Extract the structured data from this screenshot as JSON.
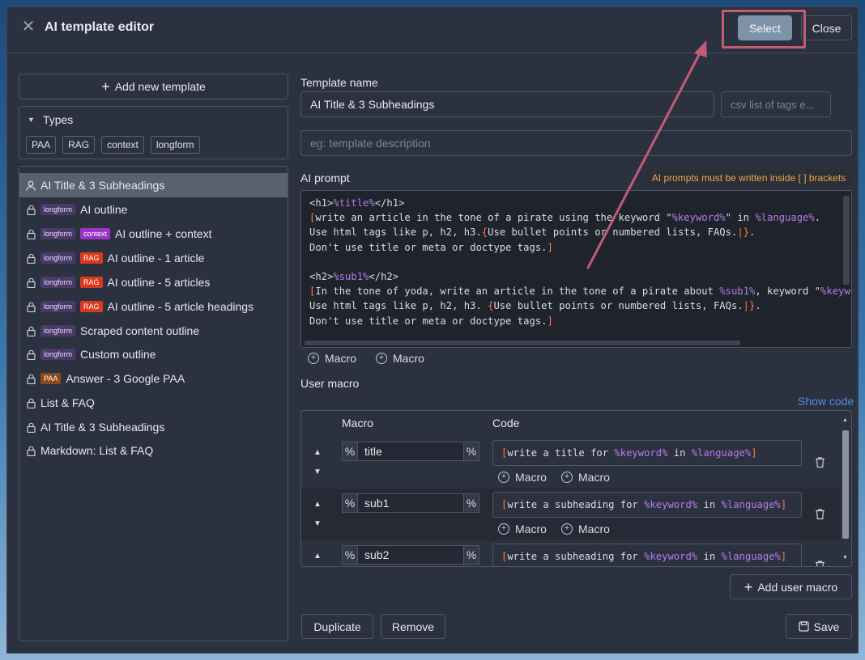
{
  "dialog": {
    "title": "AI template editor",
    "select_label": "Select",
    "close_label": "Close"
  },
  "left": {
    "add_template_label": "Add new template",
    "types_label": "Types",
    "types": [
      "PAA",
      "RAG",
      "context",
      "longform"
    ],
    "templates": [
      {
        "name": "AI Title & 3 Subheadings",
        "tags": [],
        "active": true,
        "icon": "user-icon"
      },
      {
        "name": "AI outline",
        "tags": [
          "longform"
        ]
      },
      {
        "name": "AI outline + context",
        "tags": [
          "longform",
          "context"
        ]
      },
      {
        "name": "AI outline - 1 article",
        "tags": [
          "longform",
          "RAG"
        ]
      },
      {
        "name": "AI outline - 5 articles",
        "tags": [
          "longform",
          "RAG"
        ]
      },
      {
        "name": "AI outline - 5 article headings",
        "tags": [
          "longform",
          "RAG"
        ]
      },
      {
        "name": "Scraped content outline",
        "tags": [
          "longform"
        ]
      },
      {
        "name": "Custom outline",
        "tags": [
          "longform"
        ]
      },
      {
        "name": "Answer - 3 Google PAA",
        "tags": [
          "PAA"
        ]
      },
      {
        "name": "List & FAQ",
        "tags": []
      },
      {
        "name": "AI Title & 3 Subheadings",
        "tags": []
      },
      {
        "name": "Markdown: List & FAQ",
        "tags": []
      }
    ]
  },
  "form": {
    "template_name_label": "Template name",
    "template_name_value": "AI Title & 3 Subheadings",
    "tags_placeholder": "csv list of tags e...",
    "description_placeholder": "eg: template description",
    "ai_prompt_label": "AI prompt",
    "warning": "AI prompts must be written inside [ ] brackets",
    "macro_link_label": "Macro",
    "user_macro_label": "User macro",
    "show_code_label": "Show code"
  },
  "prompt_lines": [
    [
      [
        "t",
        "<h1>"
      ],
      [
        "v",
        "%title%"
      ],
      [
        "t",
        "</h1>"
      ]
    ],
    [
      [
        "b",
        "["
      ],
      [
        "t",
        "write an article in the tone of a pirate using the keyword \""
      ],
      [
        "v",
        "%keyword%"
      ],
      [
        "t",
        "\" in "
      ],
      [
        "v",
        "%language%"
      ],
      [
        "t",
        "."
      ]
    ],
    [
      [
        "t",
        "Use html tags like p, h2, h3."
      ],
      [
        "b",
        "{"
      ],
      [
        "t",
        "Use bullet points or numbered lists, FAQs."
      ],
      [
        "b",
        "|"
      ],
      [
        "b",
        "}"
      ],
      [
        "t",
        "."
      ]
    ],
    [
      [
        "t",
        "Don't use title or meta or doctype tags."
      ],
      [
        "b",
        "]"
      ]
    ],
    [],
    [
      [
        "t",
        "<h2>"
      ],
      [
        "v",
        "%sub1%"
      ],
      [
        "t",
        "</h2>"
      ]
    ],
    [
      [
        "b",
        "["
      ],
      [
        "t",
        "In the tone of yoda, write an article in the tone of a pirate about "
      ],
      [
        "v",
        "%sub1%"
      ],
      [
        "t",
        ", keyword \""
      ],
      [
        "v",
        "%keywo"
      ]
    ],
    [
      [
        "t",
        "Use html tags like p, h2, h3. "
      ],
      [
        "b",
        "{"
      ],
      [
        "t",
        "Use bullet points or numbered lists, FAQs."
      ],
      [
        "b",
        "|"
      ],
      [
        "b",
        "}"
      ],
      [
        "t",
        "."
      ]
    ],
    [
      [
        "t",
        "Don't use title or meta or doctype tags."
      ],
      [
        "b",
        "]"
      ]
    ]
  ],
  "macro_table": {
    "col_macro": "Macro",
    "col_code": "Code",
    "pct": "%",
    "rows": [
      {
        "name": "title",
        "code": [
          [
            "b",
            "["
          ],
          [
            "t",
            "write a title for "
          ],
          [
            "v",
            "%keyword%"
          ],
          [
            "t",
            " in "
          ],
          [
            "v",
            "%language%"
          ],
          [
            "b",
            "]"
          ]
        ]
      },
      {
        "name": "sub1",
        "code": [
          [
            "b",
            "["
          ],
          [
            "t",
            "write a subheading for "
          ],
          [
            "v",
            "%keyword%"
          ],
          [
            "t",
            " in "
          ],
          [
            "v",
            "%language%"
          ],
          [
            "b",
            "]"
          ]
        ]
      },
      {
        "name": "sub2",
        "code": [
          [
            "b",
            "["
          ],
          [
            "t",
            "write a subheading for "
          ],
          [
            "v",
            "%keyword%"
          ],
          [
            "t",
            " in "
          ],
          [
            "v",
            "%language%"
          ],
          [
            "b",
            "]"
          ]
        ]
      }
    ]
  },
  "buttons": {
    "add_user_macro": "Add user macro",
    "duplicate": "Duplicate",
    "remove": "Remove",
    "save": "Save"
  },
  "colors": {
    "accent_select": "#7d93a8",
    "highlight": "#c25b73",
    "variable": "#b47ce8",
    "bracket": "#ff7a45",
    "warning": "#f0a64a",
    "link": "#4f8fd8"
  }
}
